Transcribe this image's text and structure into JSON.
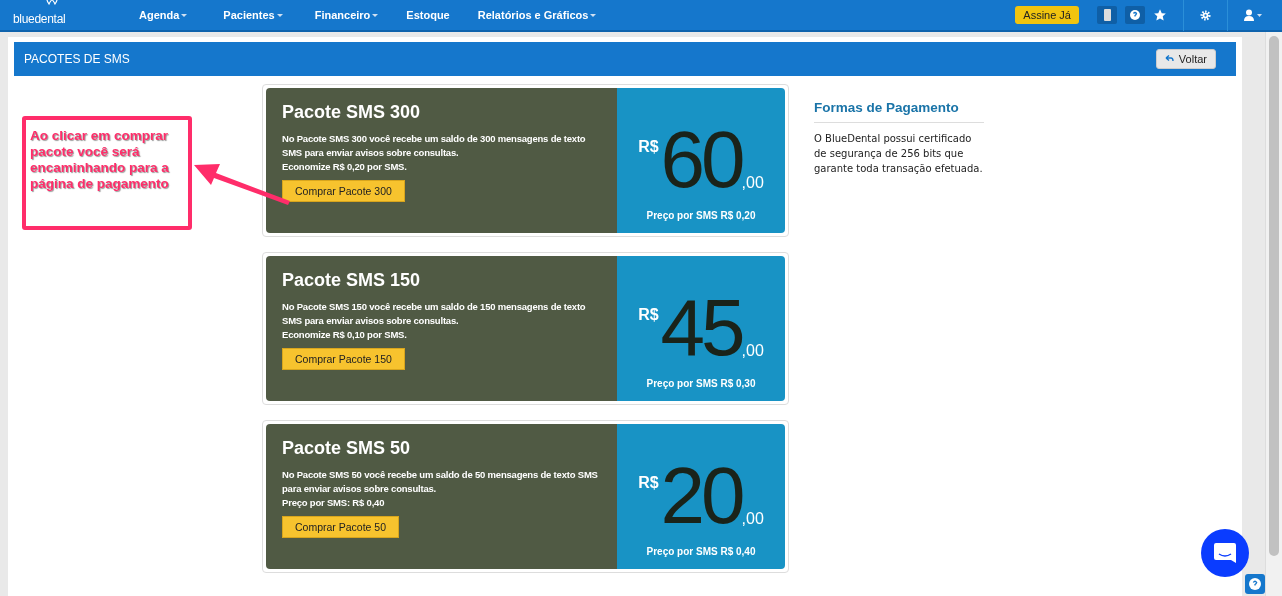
{
  "navbar": {
    "logo": "bluedental",
    "menu": [
      {
        "label": "Agenda",
        "dropdown": true
      },
      {
        "label": "Pacientes",
        "dropdown": true
      },
      {
        "label": "Financeiro",
        "dropdown": true
      },
      {
        "label": "Estoque",
        "dropdown": false
      },
      {
        "label": "Relatórios e Gráficos",
        "dropdown": true
      }
    ],
    "cta": "Assine Já"
  },
  "page": {
    "title": "PACOTES DE SMS",
    "back_button": "Voltar"
  },
  "annotation": {
    "text": "Ao clicar em comprar pacote você será encaminhando para a página de pagamento"
  },
  "packages": [
    {
      "title": "Pacote SMS 300",
      "description": "No Pacote SMS 300 você recebe um saldo de 300 mensagens de texto SMS para enviar avisos sobre consultas.",
      "note": "Economize R$ 0,20 por SMS.",
      "button": "Comprar Pacote 300",
      "currency": "R$",
      "price": "60",
      "cents": ",00",
      "unit_price": "Preço por SMS R$ 0,20"
    },
    {
      "title": "Pacote SMS 150",
      "description": "No Pacote SMS 150 você recebe um saldo de 150 mensagens de texto SMS para enviar avisos sobre consultas.",
      "note": "Economize R$ 0,10 por SMS.",
      "button": "Comprar Pacote 150",
      "currency": "R$",
      "price": "45",
      "cents": ",00",
      "unit_price": "Preço por SMS R$ 0,30"
    },
    {
      "title": "Pacote SMS 50",
      "description": "No Pacote SMS 50 você recebe um saldo de 50 mensagens de texto SMS para enviar avisos sobre consultas.",
      "note": "Preço por SMS: R$ 0,40",
      "button": "Comprar Pacote 50",
      "currency": "R$",
      "price": "20",
      "cents": ",00",
      "unit_price": "Preço por SMS R$ 0,40"
    }
  ],
  "payment": {
    "title": "Formas de Pagamento",
    "text": "O BlueDental possui certificado de segurança de 256 bits que garante toda transação efetuada."
  }
}
